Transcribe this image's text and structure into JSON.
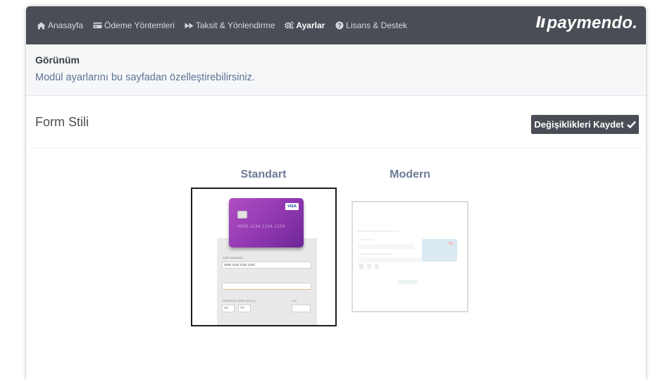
{
  "nav": {
    "items": [
      {
        "label": "Anasayfa",
        "icon": "home-icon"
      },
      {
        "label": "Ödeme Yöntemleri",
        "icon": "credit-card-icon"
      },
      {
        "label": "Taksit & Yönlendirme",
        "icon": "fast-forward-icon"
      },
      {
        "label": "Ayarlar",
        "icon": "cogs-icon",
        "active": true
      },
      {
        "label": "Lisans & Destek",
        "icon": "question-circle-icon"
      }
    ],
    "brand": "paymendo."
  },
  "header": {
    "title": "Görünüm",
    "description": "Modül ayarlarını bu sayfadan özelleştirebilirsiniz."
  },
  "form_style": {
    "title": "Form Stili",
    "save_label": "Değişiklikleri Kaydet",
    "save_icon": "check-icon",
    "options": [
      {
        "label": "Standart",
        "selected": true
      },
      {
        "label": "Modern",
        "selected": false
      }
    ]
  },
  "standard_preview": {
    "card_brand": "VISA",
    "card_number_on_card": "4506 1234 1234 1234",
    "card_number_label": "KART NUMARASI",
    "card_number_value": "4506 1234 1234 1234",
    "expiry_label": "GEÇERLİLİK TARİHİ (AY/YIL)",
    "month_value": "AA",
    "year_value": "YY",
    "cvc_label": "CVC"
  },
  "colors": {
    "navbar": "#4a4d55",
    "accent_text": "#5d7390",
    "selected_border": "#1d1d1d",
    "card": "#9b3fb8"
  }
}
